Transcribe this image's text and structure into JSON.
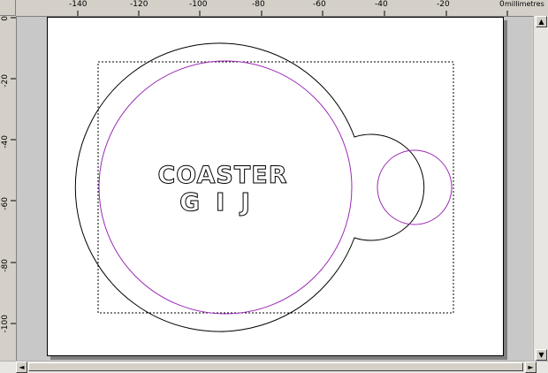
{
  "ruler": {
    "units": "millimetres",
    "top_ticks": [
      "-140",
      "-120",
      "-100",
      "-80",
      "-60",
      "-40",
      "-20",
      "0"
    ],
    "left_ticks": [
      "0",
      "-20",
      "-40",
      "-60",
      "-80",
      "-100"
    ]
  },
  "artwork": {
    "text_line_1": "COASTER",
    "text_line_2": "GIJ"
  },
  "colors": {
    "outline": "#000000",
    "inner_circle": "#9b2bb5",
    "selection": "#000000"
  },
  "scrollbar": {
    "left_arrow": "◄",
    "right_arrow": "►",
    "up_arrow": "▲",
    "down_arrow": "▼"
  }
}
